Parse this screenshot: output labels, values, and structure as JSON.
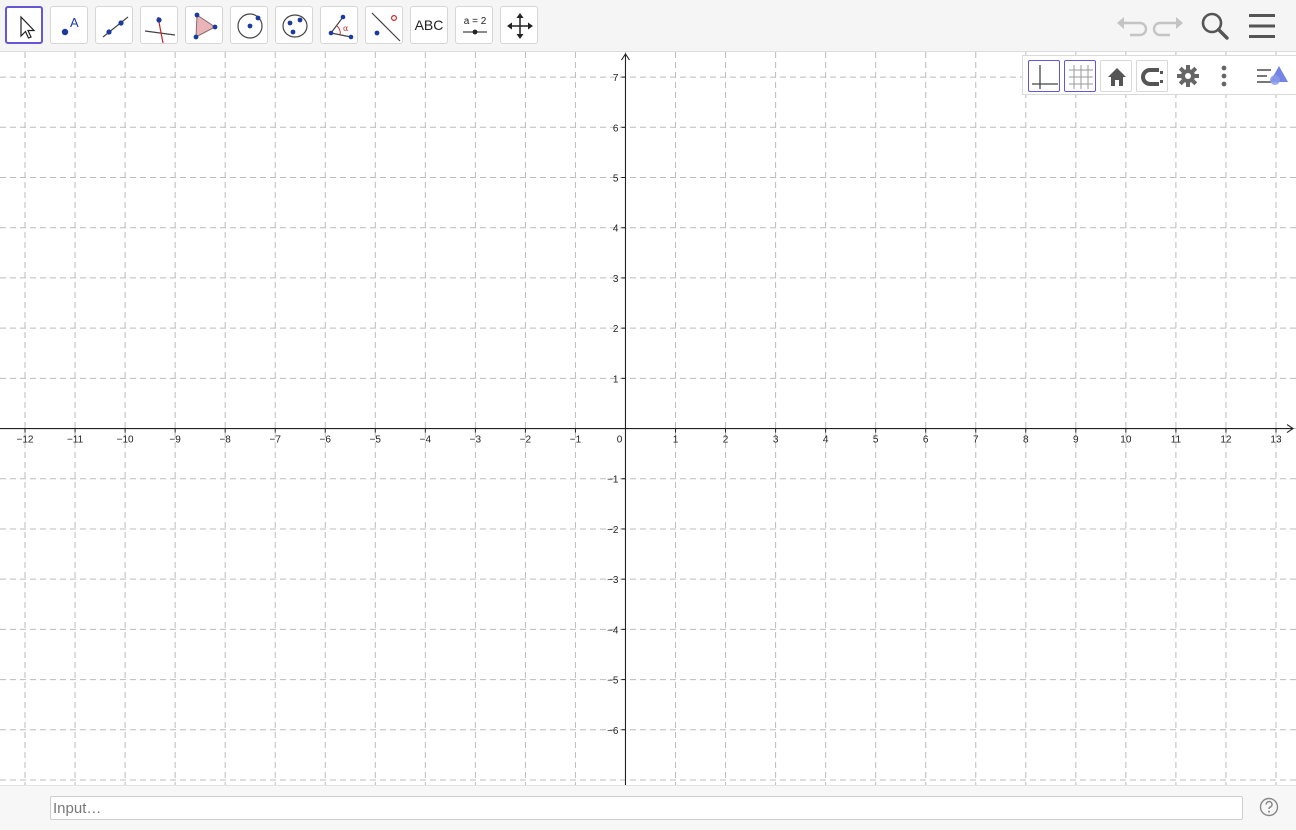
{
  "toolbar": {
    "tools": [
      {
        "name": "Move"
      },
      {
        "name": "Point",
        "icon_text": "A"
      },
      {
        "name": "Line"
      },
      {
        "name": "Perpendicular Line"
      },
      {
        "name": "Polygon"
      },
      {
        "name": "Circle with Center through Point"
      },
      {
        "name": "Ellipse"
      },
      {
        "name": "Angle",
        "icon_text": "α"
      },
      {
        "name": "Reflect about Line"
      },
      {
        "name": "Text",
        "icon_text": "ABC"
      },
      {
        "name": "Slider",
        "icon_text": "a = 2"
      },
      {
        "name": "Move Graphics View"
      }
    ],
    "selected_tool": "Move",
    "right_icons": [
      "undo-icon",
      "redo-icon",
      "search-icon",
      "menu-icon"
    ]
  },
  "graphics": {
    "x_ticks": [
      "−12",
      "−11",
      "−10",
      "−9",
      "−8",
      "−7",
      "−6",
      "−5",
      "−4",
      "−3",
      "−2",
      "−1",
      "0",
      "1",
      "2",
      "3",
      "4",
      "5",
      "6",
      "7",
      "8",
      "9",
      "10",
      "11",
      "12",
      "13"
    ],
    "y_ticks": [
      "7",
      "6",
      "5",
      "4",
      "3",
      "2",
      "1",
      "−1",
      "−2",
      "−3",
      "−4",
      "−5",
      "−6"
    ],
    "x_range": [
      -12.5,
      13.4
    ],
    "y_range": [
      -7.1,
      7.5
    ],
    "grid": true,
    "axes": true
  },
  "stylebar": {
    "buttons": [
      "axes-toggle-icon",
      "grid-toggle-icon",
      "home-icon",
      "point-capturing-icon",
      "settings-icon",
      "more-vert-icon",
      "algebra-view-toggle-icon"
    ],
    "axes_on": true,
    "grid_on": true
  },
  "inputbar": {
    "placeholder": "Input…",
    "value": ""
  },
  "colors": {
    "accent": "#6557d2",
    "point": "#1565c0",
    "perp_line": "#d32f2f"
  }
}
